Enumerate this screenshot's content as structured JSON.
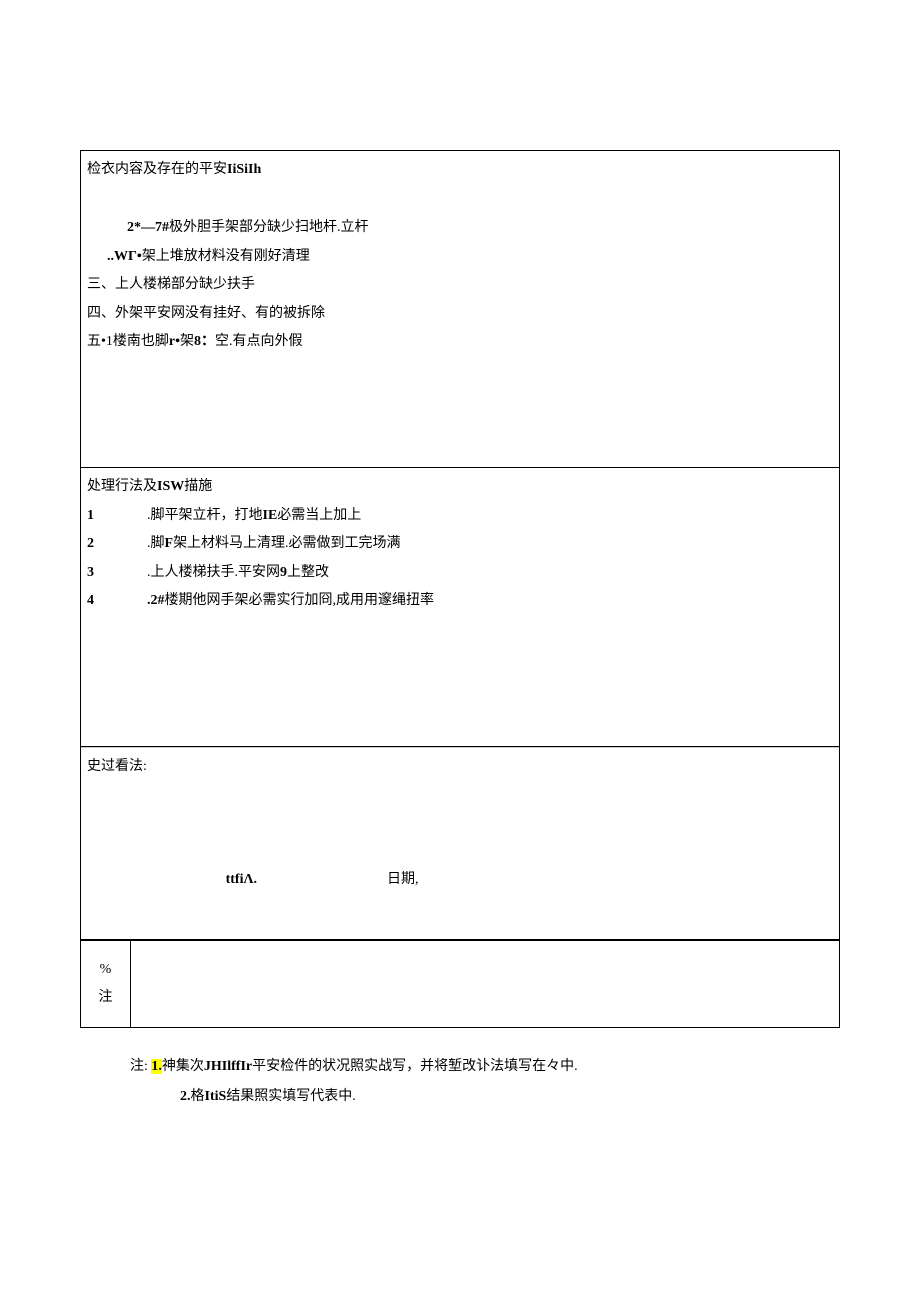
{
  "section1": {
    "title_prefix": "检衣内容及存在的平安",
    "title_suffix": "IiSiIh",
    "items": [
      {
        "indent": "indent-1",
        "prefix_bold": "2*—7#",
        "text": "极外胆手架部分缺少扫地杆.立杆"
      },
      {
        "indent": "indent-half",
        "prefix_bold": "..WГ•",
        "text": "架上堆放材料没有刚好清理"
      },
      {
        "indent": "",
        "prefix_bold": "",
        "text": "三、上人楼梯部分缺少扶手"
      },
      {
        "indent": "",
        "prefix_bold": "",
        "text": "四、外架平安网没有挂好、有的被拆除"
      },
      {
        "indent": "",
        "prefix_bold": "五•1",
        "mid": "楼南也脚",
        "mid_bold": "r•",
        "mid2": "架",
        "mid_bold2": "8：",
        "text": "空.有点向外假"
      }
    ]
  },
  "section2": {
    "title_prefix": "处理行法及",
    "title_bold": "ISW",
    "title_suffix": "描施",
    "items": [
      {
        "num": "1",
        "prefix": ".脚平架立杆，打地",
        "bold": "IE",
        "suffix": "必需当上加上"
      },
      {
        "num": "2",
        "prefix": ".脚",
        "bold": "F",
        "suffix": "架上材料马上清理.必需做到工完场满"
      },
      {
        "num": "3",
        "prefix": ".上人楼梯扶手.平安网",
        "bold": "9",
        "suffix": "上整改"
      },
      {
        "num": "4",
        "prefix": "",
        "bold": ".2#",
        "suffix": "楼期他网手架必需实行加冏,成用用邃绳扭率"
      }
    ]
  },
  "section3": {
    "title": "史过看法:",
    "sign_label": "ttfiΛ.",
    "date_label": "日期,"
  },
  "remark": {
    "label1": "%",
    "label2": "注"
  },
  "footer": {
    "prefix": "注:",
    "line1_bold": "1.",
    "line1_mid": "神集次",
    "line1_bold2": "JHIlffIr",
    "line1_suffix": "平安检件的状况照实战写，并将堑改讣法填写在々中.",
    "line2_bold": "2.",
    "line2_mid": "格",
    "line2_bold2": "ItiS",
    "line2_suffix": "结果照实填写代表中."
  }
}
